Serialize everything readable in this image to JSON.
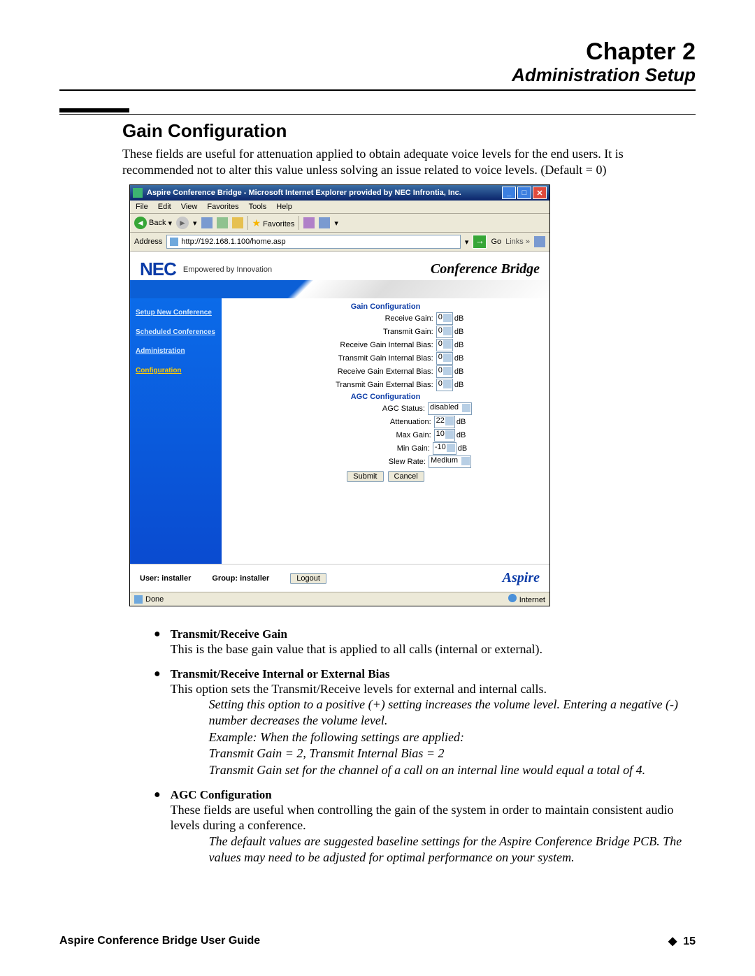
{
  "header": {
    "chapter": "Chapter 2",
    "subtitle": "Administration Setup"
  },
  "section": {
    "title": "Gain Configuration",
    "intro": "These fields are useful for attenuation applied to obtain adequate voice levels for the end users. It is recommended not to alter this value unless solving an issue related to voice levels. (Default = 0)"
  },
  "ie": {
    "title": "Aspire Conference Bridge - Microsoft Internet Explorer provided by NEC Infrontia, Inc.",
    "menu": [
      "File",
      "Edit",
      "View",
      "Favorites",
      "Tools",
      "Help"
    ],
    "back": "Back",
    "favorites": "Favorites",
    "addr_label": "Address",
    "url": "http://192.168.1.100/home.asp",
    "go": "Go",
    "links": "Links",
    "status": "Done",
    "zone": "Internet"
  },
  "app": {
    "logo": "NEC",
    "tagline": "Empowered by Innovation",
    "cb": "Conference Bridge",
    "side": {
      "new": "Setup New Conference",
      "sched": "Scheduled Conferences",
      "admin": "Administration",
      "config": "Configuration"
    },
    "gain_title": "Gain Configuration",
    "agc_title": "AGC Configuration",
    "fields": {
      "rx_gain": {
        "label": "Receive Gain:",
        "val": "0",
        "unit": "dB"
      },
      "tx_gain": {
        "label": "Transmit Gain:",
        "val": "0",
        "unit": "dB"
      },
      "rx_int": {
        "label": "Receive Gain Internal Bias:",
        "val": "0",
        "unit": "dB"
      },
      "tx_int": {
        "label": "Transmit Gain Internal Bias:",
        "val": "0",
        "unit": "dB"
      },
      "rx_ext": {
        "label": "Receive Gain External Bias:",
        "val": "0",
        "unit": "dB"
      },
      "tx_ext": {
        "label": "Transmit Gain External Bias:",
        "val": "0",
        "unit": "dB"
      },
      "agc_status": {
        "label": "AGC Status:",
        "val": "disabled"
      },
      "atten": {
        "label": "Attenuation:",
        "val": "22",
        "unit": "dB"
      },
      "max": {
        "label": "Max Gain:",
        "val": "10",
        "unit": "dB"
      },
      "min": {
        "label": "Min Gain:",
        "val": "-10",
        "unit": "dB"
      },
      "slew": {
        "label": "Slew Rate:",
        "val": "Medium"
      }
    },
    "submit": "Submit",
    "cancel": "Cancel",
    "user_label": "User: installer",
    "group_label": "Group: installer",
    "logout": "Logout",
    "aspire": "Aspire"
  },
  "bullets": {
    "b1": {
      "title": "Transmit/Receive Gain",
      "text": "This is the base gain value that is applied to all calls (internal or external)."
    },
    "b2": {
      "title": "Transmit/Receive Internal or External Bias",
      "text": "This option sets the Transmit/Receive levels for external and internal calls.",
      "it1": "Setting this option to a positive (+) setting increases the volume level. Entering a negative (-) number decreases the volume level.",
      "it2": "Example: When the following settings are applied:",
      "it3": "Transmit Gain = 2, Transmit Internal Bias = 2",
      "it4": "Transmit Gain set for the channel of a call on an internal line would equal a total of 4."
    },
    "b3": {
      "title": "AGC Configuration",
      "text": "These fields are useful when controlling the gain of the system in order to maintain consistent audio levels during a conference.",
      "it1": "The default values are suggested baseline settings for the Aspire Conference Bridge PCB. The values may need to be adjusted for optimal performance on your system."
    }
  },
  "footer": {
    "book": "Aspire Conference Bridge User Guide",
    "diamond": "◆",
    "page": "15"
  }
}
